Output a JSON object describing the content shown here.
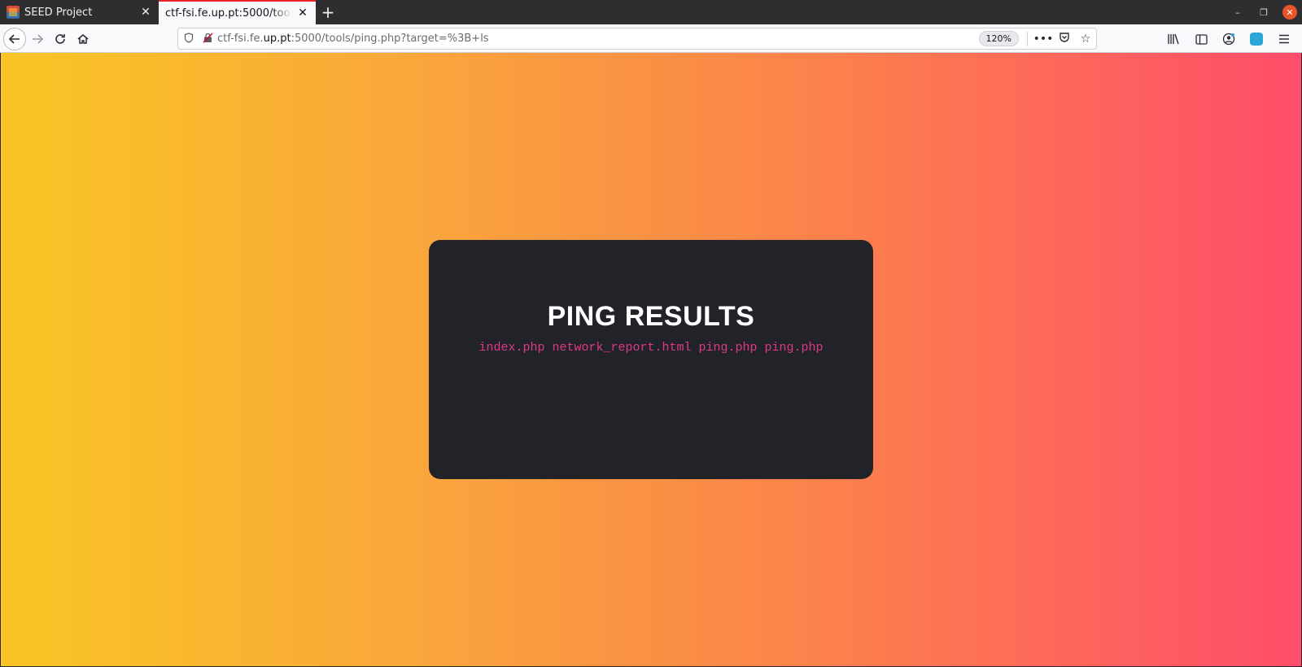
{
  "tabs": [
    {
      "title": "SEED Project",
      "active": false
    },
    {
      "title": "ctf-fsi.fe.up.pt:5000/tools/p",
      "active": true
    }
  ],
  "nav": {
    "url_prefix": "ctf-fsi.fe.",
    "url_domain": "up.pt",
    "url_rest": ":5000/tools/ping.php?target=%3B+ls",
    "zoom": "120%"
  },
  "page": {
    "heading": "PING RESULTS",
    "output": "index.php network_report.html ping.php ping.php"
  },
  "colors": {
    "gradient_start": "#f9c524",
    "gradient_end": "#ff4d6a",
    "card_bg": "#212329",
    "output_text": "#e0398a"
  }
}
